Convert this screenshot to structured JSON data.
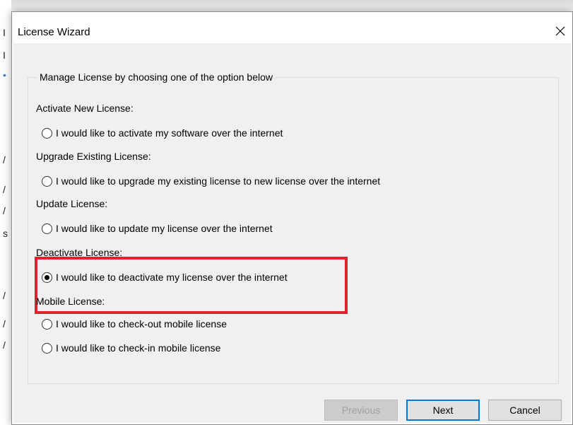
{
  "background": {
    "glyphs": [
      "I",
      "I",
      "•",
      "/",
      "/",
      "/",
      "s",
      "/",
      "/",
      "/"
    ]
  },
  "window": {
    "title": "License Wizard",
    "close_symbol": "✕"
  },
  "group": {
    "legend": "Manage License by choosing one of the option below"
  },
  "sections": [
    {
      "heading": "Activate New License:",
      "options": [
        {
          "label": "I would like to activate my software over the internet",
          "selected": false
        }
      ]
    },
    {
      "heading": "Upgrade Existing License:",
      "options": [
        {
          "label": "I would like to upgrade my existing license to new license over the internet",
          "selected": false
        }
      ]
    },
    {
      "heading": "Update License:",
      "options": [
        {
          "label": "I would like to update my license over the internet",
          "selected": false
        }
      ]
    },
    {
      "heading": "Deactivate License:",
      "options": [
        {
          "label": "I would like to deactivate my license over the internet",
          "selected": true
        }
      ]
    },
    {
      "heading": "Mobile License:",
      "options": [
        {
          "label": "I would like to check-out mobile license",
          "selected": false
        },
        {
          "label": "I would like to check-in mobile license",
          "selected": false
        }
      ]
    }
  ],
  "buttons": {
    "previous": "Previous",
    "next": "Next",
    "cancel": "Cancel"
  },
  "colors": {
    "highlight": "#e3202e",
    "default_button_border": "#0078d7",
    "dialog_background": "#f0f0f0"
  }
}
